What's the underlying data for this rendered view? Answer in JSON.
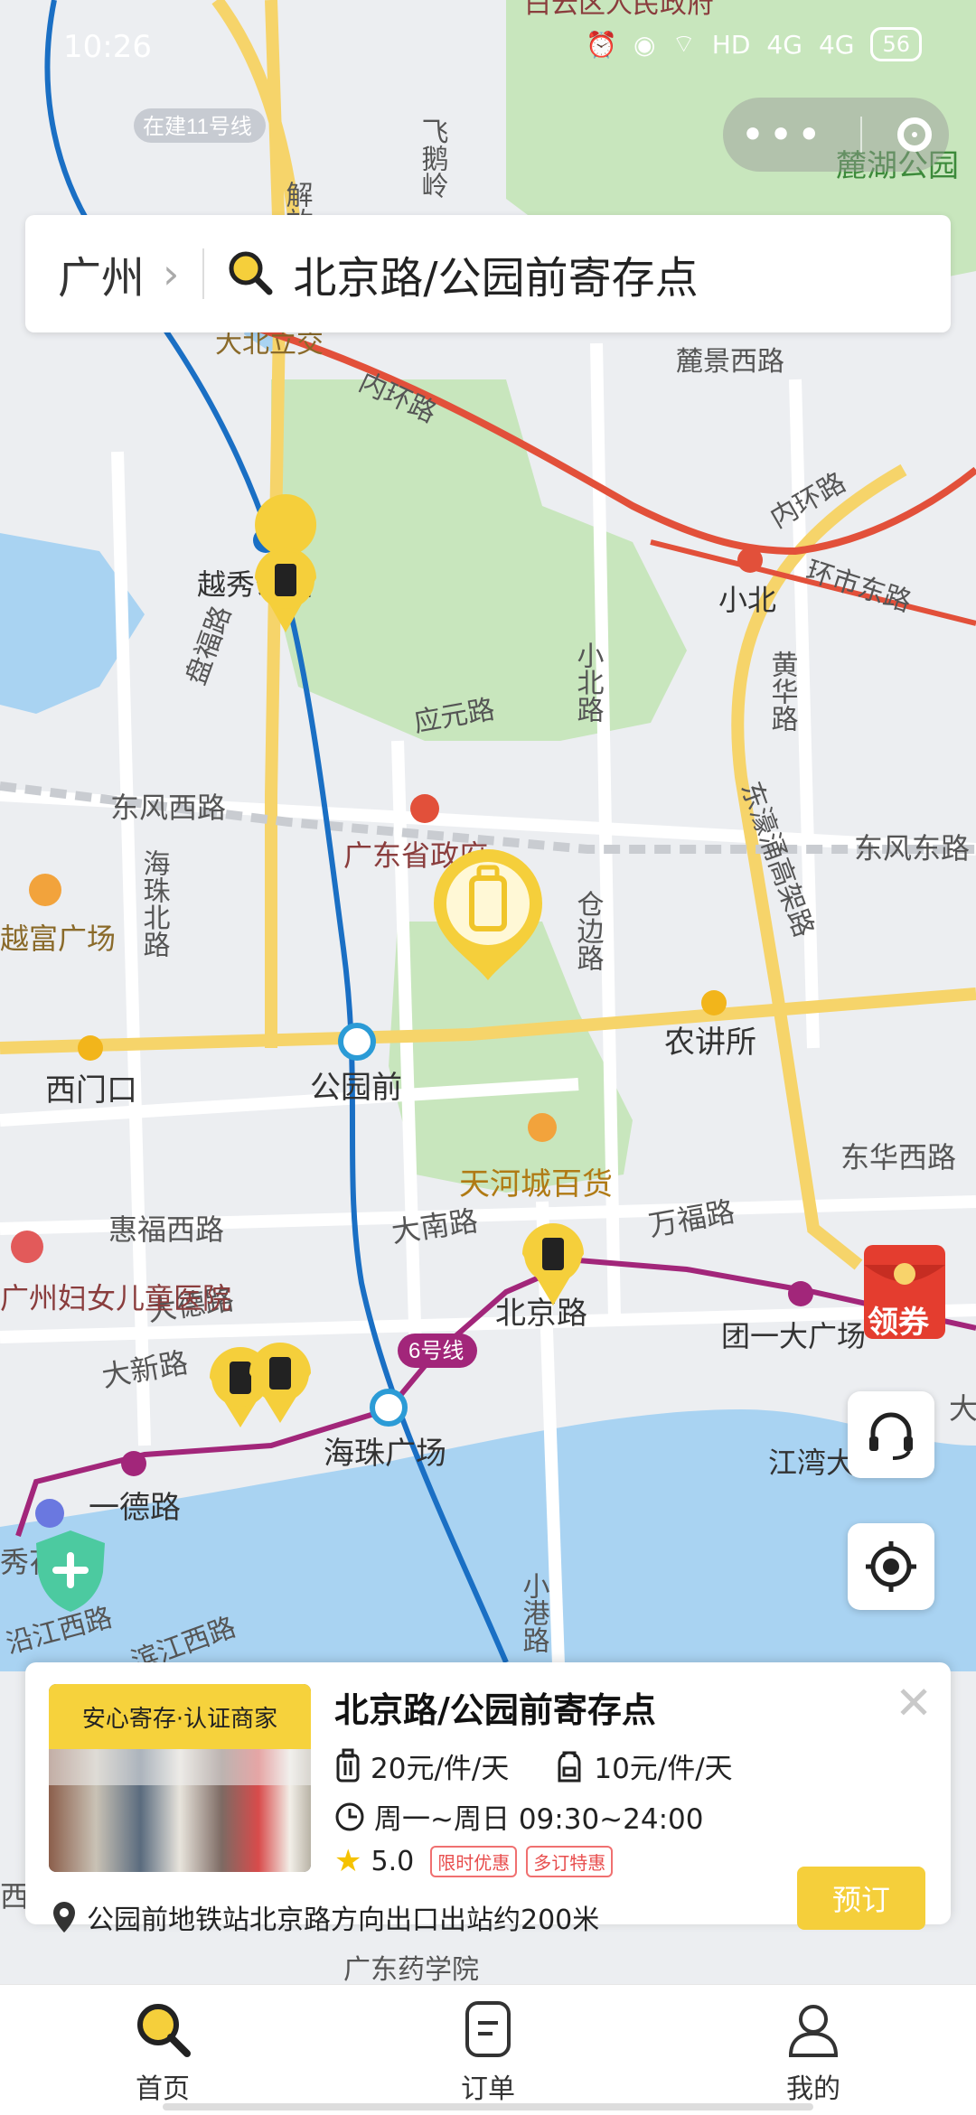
{
  "status_bar": {
    "time": "10:26",
    "network": "HD",
    "signal_1": "4G",
    "signal_2": "4G",
    "battery": "56"
  },
  "search": {
    "city": "广州",
    "query": "北京路/公园前寄存点"
  },
  "map": {
    "labels": {
      "district_gov": "白云区人民政府",
      "planned_line": "在建11号线",
      "line_top": "号线",
      "jiefang_road": "解放",
      "feieling": "飞鹅岭",
      "luhu_park": "麓湖公园",
      "dabei": "大北立交",
      "inner_ring": "内环路",
      "lujing": "麓景西路",
      "inner_ring_2": "内环路",
      "huanshi": "环市东路",
      "xiaobei_station": "小北",
      "yuexiu_park": "越秀公园",
      "panfu": "盘福路",
      "yingyuan": "应元路",
      "xiaobei_road": "小北路",
      "huanghua": "黄华路",
      "dongfeng_west": "东风西路",
      "dongfeng_east": "东风东路",
      "dongfeng_viaduct": "东濠涌高架路",
      "guangdong_gov": "广东省政府",
      "haizhu_north": "海珠北路",
      "cangbian": "仓边路",
      "yuefu": "越富广场",
      "ximenkou": "西门口",
      "gongyuanqian": "公园前",
      "nongjiangsuo": "农讲所",
      "donghua_west": "东华西路",
      "tianhecheng": "天河城百货",
      "huifu": "惠福西路",
      "danan": "大南路",
      "wanfu": "万福路",
      "dade": "大德路",
      "beijinglu": "北京路",
      "tuanyi": "团一大广场",
      "women_hospital": "广州妇女儿童医院",
      "daxin": "大新路",
      "line6": "6号线",
      "haizhu_square": "海珠广场",
      "yide": "一德路",
      "jiangwan": "江湾大",
      "xiugarden": "秀花园",
      "yanjiang": "沿江西路",
      "binjiang": "滨江西路",
      "xiaogang": "小港路",
      "dasha": "大沙",
      "yuexiu_west": "西",
      "yaoxueyuan": "广东药学院"
    }
  },
  "coupon_label": "领券",
  "store_card": {
    "badge": "安心寄存·认证商家",
    "name": "北京路/公园前寄存点",
    "price_luggage": "20元/件/天",
    "price_bag": "10元/件/天",
    "hours": "周一~周日 09:30~24:00",
    "rating": "5.0",
    "tag_1": "限时优惠",
    "tag_2": "多订特惠",
    "book_label": "预订",
    "address": "公园前地铁站北京路方向出口出站约200米"
  },
  "tabs": [
    {
      "label": "首页",
      "icon": "search-icon"
    },
    {
      "label": "订单",
      "icon": "order-icon"
    },
    {
      "label": "我的",
      "icon": "profile-icon"
    }
  ],
  "colors": {
    "accent": "#f5cf3b",
    "metro_blue": "#1a6fc4",
    "metro_purple": "#a2267a",
    "ring_road_red": "#e2503a",
    "park_green": "#c8e6bd",
    "river_blue": "#a9d3f2"
  }
}
